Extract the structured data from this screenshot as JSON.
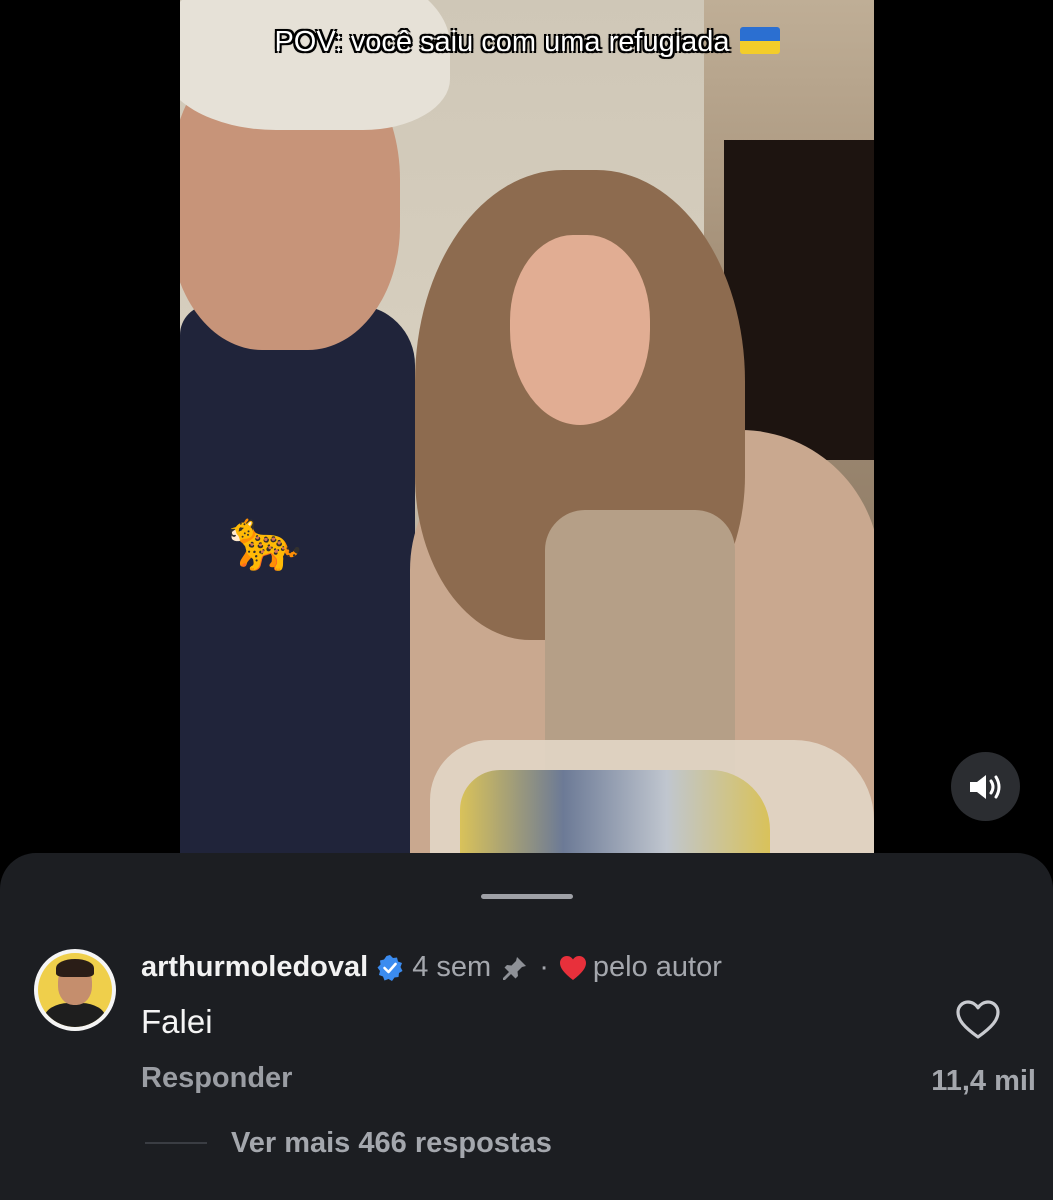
{
  "video": {
    "caption": "POV: você saiu com uma refugiada",
    "caption_emoji": "ukraine-flag"
  },
  "comment": {
    "username": "arthurmoledoval",
    "verified": true,
    "time": "4 sem",
    "separator": "·",
    "liked_by_author_label": "pelo autor",
    "text": "Falei",
    "reply_label": "Responder",
    "like_count": "11,4 mil",
    "more_replies_label": "Ver mais 466 respostas"
  },
  "colors": {
    "sheet_background": "#1c1e22",
    "verified_blue": "#3b8cf0",
    "heart_red": "#e8303b",
    "muted_text": "#a4a7ad"
  }
}
